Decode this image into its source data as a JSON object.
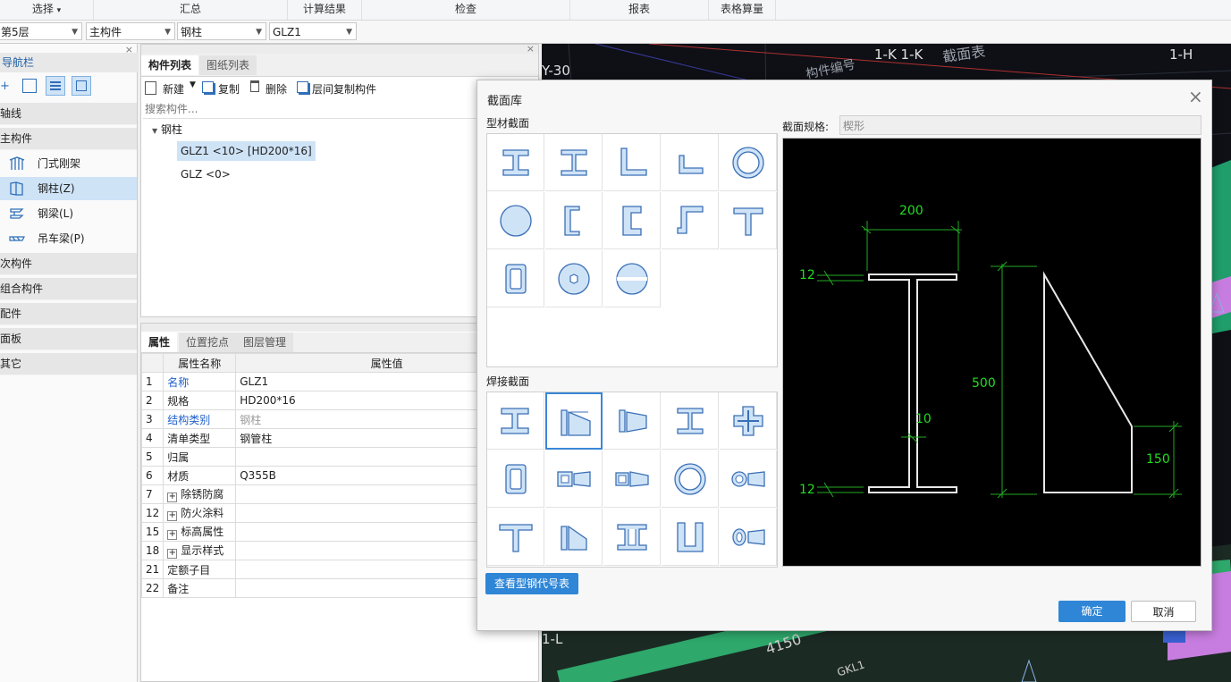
{
  "menubar": {
    "items": [
      "选择",
      "汇总",
      "计算结果",
      "检查",
      "报表",
      "表格算量"
    ],
    "select_arrow": "▾"
  },
  "selectors": {
    "floor": "第5层",
    "category": "主构件",
    "type": "钢柱",
    "component": "GLZ1"
  },
  "nav": {
    "title": "导航栏",
    "categories": [
      "轴线",
      "主构件",
      "次构件",
      "组合构件",
      "配件",
      "面板",
      "其它"
    ],
    "items": [
      {
        "label": "门式刚架",
        "icon": "portal-frame-icon"
      },
      {
        "label": "钢柱(Z)",
        "icon": "steel-column-icon"
      },
      {
        "label": "钢梁(L)",
        "icon": "steel-beam-icon"
      },
      {
        "label": "吊车梁(P)",
        "icon": "crane-beam-icon"
      }
    ]
  },
  "component_panel": {
    "tabs": [
      "构件列表",
      "图纸列表"
    ],
    "toolbar": {
      "new": "新建",
      "copy": "复制",
      "delete": "删除",
      "floor_copy": "层间复制构件"
    },
    "search_placeholder": "搜索构件...",
    "tree_root": "钢柱",
    "tree_items": [
      "GLZ1 <10> [HD200*16]",
      "GLZ <0>"
    ]
  },
  "properties": {
    "tabs": [
      "属性",
      "位置挖点",
      "图层管理"
    ],
    "header": {
      "name": "属性名称",
      "value": "属性值"
    },
    "rows": [
      {
        "no": "1",
        "name": "名称",
        "value": "GLZ1",
        "blue": true,
        "expand": false
      },
      {
        "no": "2",
        "name": "规格",
        "value": "HD200*16",
        "blue": false,
        "expand": false
      },
      {
        "no": "3",
        "name": "结构类别",
        "value": "钢柱",
        "blue": true,
        "expand": false,
        "grey": true
      },
      {
        "no": "4",
        "name": "清单类型",
        "value": "钢管柱",
        "blue": false,
        "expand": false
      },
      {
        "no": "5",
        "name": "归属",
        "value": "",
        "blue": false,
        "expand": false
      },
      {
        "no": "6",
        "name": "材质",
        "value": "Q355B",
        "blue": false,
        "expand": false
      },
      {
        "no": "7",
        "name": "除锈防腐",
        "value": "",
        "blue": false,
        "expand": true
      },
      {
        "no": "12",
        "name": "防火涂料",
        "value": "",
        "blue": false,
        "expand": true
      },
      {
        "no": "15",
        "name": "标高属性",
        "value": "",
        "blue": false,
        "expand": true
      },
      {
        "no": "18",
        "name": "显示样式",
        "value": "",
        "blue": false,
        "expand": true
      },
      {
        "no": "21",
        "name": "定额子目",
        "value": "",
        "blue": false,
        "expand": false
      },
      {
        "no": "22",
        "name": "备注",
        "value": "",
        "blue": false,
        "expand": false
      }
    ]
  },
  "cad": {
    "labels": [
      "Y-30",
      "1-K 1-K",
      "1-H",
      "构件编号",
      "截面表",
      "1-L",
      "4150",
      "GKL1"
    ]
  },
  "dialog": {
    "title": "截面库",
    "section_profile": "型材截面",
    "section_welded": "焊接截面",
    "spec_label": "截面规格:",
    "spec_value": "楔形",
    "view_codes_btn": "查看型钢代号表",
    "ok": "确定",
    "cancel": "取消",
    "dims": {
      "width": "200",
      "height": "500",
      "flange_top": "12",
      "flange_bottom": "12",
      "web": "10",
      "taper_end": "150"
    },
    "colors": {
      "dim": "#22dd22",
      "shape": "#e8e8e8",
      "accent": "#2f86d6"
    }
  }
}
